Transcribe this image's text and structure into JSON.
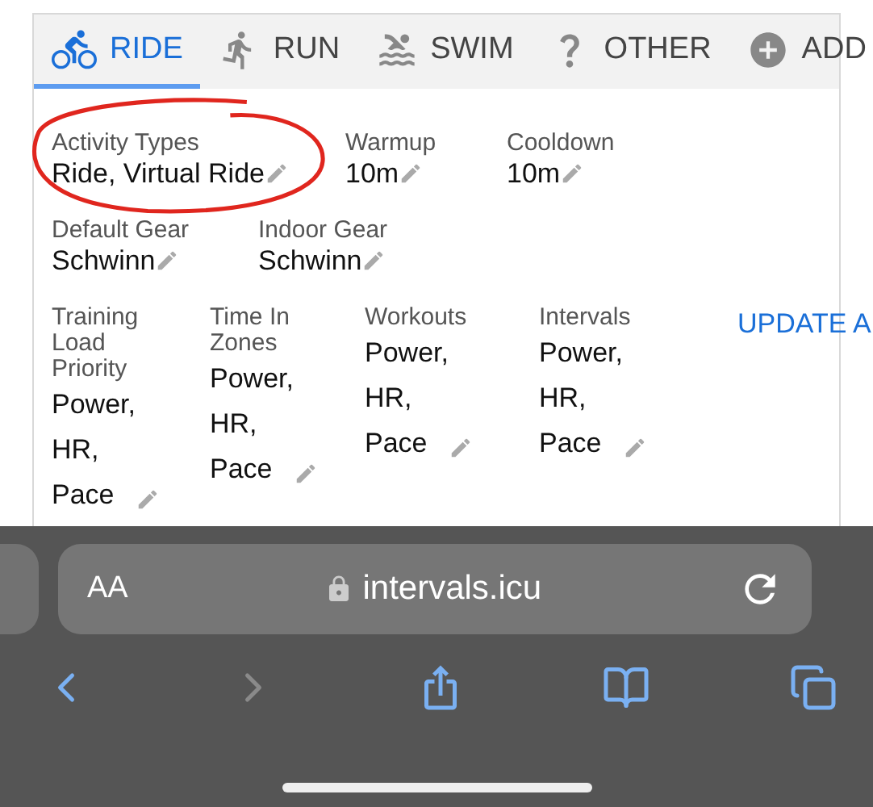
{
  "tabs": [
    {
      "label": "RIDE",
      "selected": true
    },
    {
      "label": "RUN",
      "selected": false
    },
    {
      "label": "SWIM",
      "selected": false
    },
    {
      "label": "OTHER",
      "selected": false
    },
    {
      "label": "ADD",
      "selected": false
    }
  ],
  "rows": [
    {
      "fields": [
        {
          "label": "Activity Types",
          "value": "Ride, Virtual Ride",
          "circled": true
        },
        {
          "label": "Warmup",
          "value": "10m",
          "circled": false
        },
        {
          "label": "Cooldown",
          "value": "10m",
          "circled": false
        }
      ]
    },
    {
      "fields": [
        {
          "label": "Default Gear",
          "value": "Schwinn",
          "circled": false
        },
        {
          "label": "Indoor Gear",
          "value": "Schwinn",
          "circled": false
        }
      ]
    },
    {
      "fields": [
        {
          "label": "Training Load Priority",
          "value": "Power, HR, Pace",
          "circled": false
        },
        {
          "label": "Time In Zones",
          "value": "Power, HR, Pace",
          "circled": false
        },
        {
          "label": "Workouts",
          "value": "Power, HR, Pace",
          "circled": false
        },
        {
          "label": "Intervals",
          "value": "Power, HR, Pace",
          "circled": false
        }
      ]
    }
  ],
  "update_button": "UPDATE A",
  "browser": {
    "text_size": "AA",
    "url": "intervals.icu",
    "back_enabled": true,
    "forward_enabled": false
  }
}
